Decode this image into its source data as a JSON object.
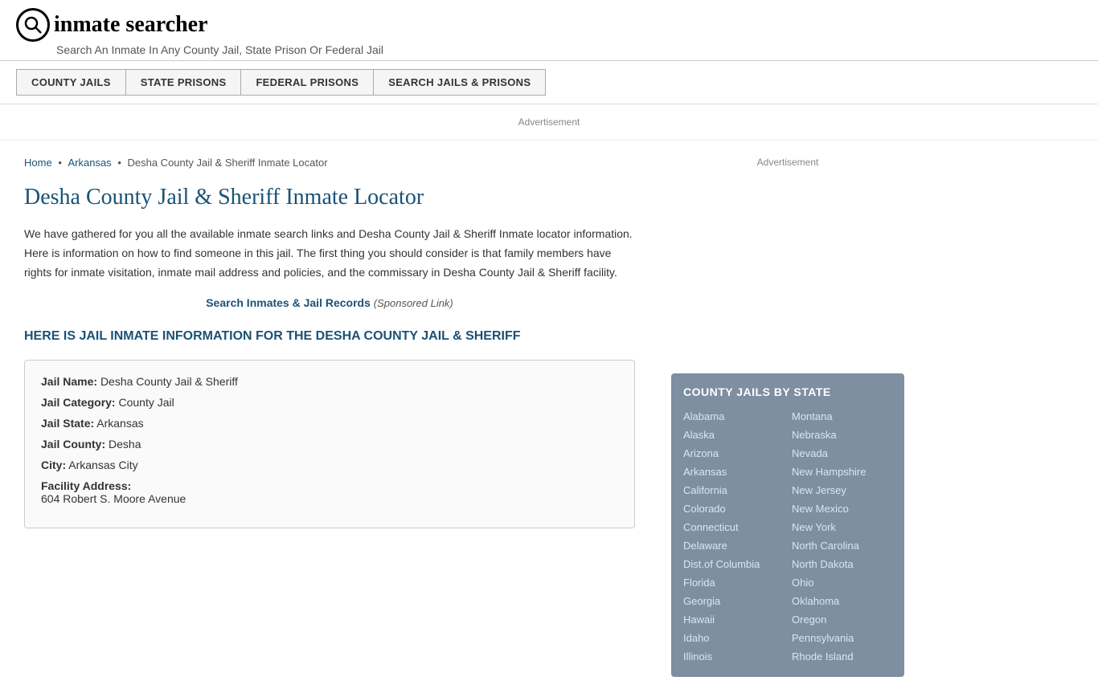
{
  "header": {
    "logo_icon": "🔍",
    "logo_text": "inmate searcher",
    "tagline": "Search An Inmate In Any County Jail, State Prison Or Federal Jail"
  },
  "nav": {
    "items": [
      {
        "label": "COUNTY JAILS",
        "id": "county-jails"
      },
      {
        "label": "STATE PRISONS",
        "id": "state-prisons"
      },
      {
        "label": "FEDERAL PRISONS",
        "id": "federal-prisons"
      },
      {
        "label": "SEARCH JAILS & PRISONS",
        "id": "search-jails-prisons"
      }
    ]
  },
  "ad_label": "Advertisement",
  "breadcrumb": {
    "home": "Home",
    "state": "Arkansas",
    "current": "Desha County Jail & Sheriff Inmate Locator"
  },
  "page_title": "Desha County Jail & Sheriff Inmate Locator",
  "intro_text": "We have gathered for you all the available inmate search links and Desha County Jail & Sheriff Inmate locator information. Here is information on how to find someone in this jail. The first thing you should consider is that family members have rights for inmate visitation, inmate mail address and policies, and the commissary in Desha County Jail & Sheriff facility.",
  "sponsored_link": {
    "text": "Search Inmates & Jail Records",
    "note": "(Sponsored Link)"
  },
  "section_heading": "HERE IS JAIL INMATE INFORMATION FOR THE DESHA COUNTY JAIL & SHERIFF",
  "jail_info": {
    "name_label": "Jail Name:",
    "name_value": "Desha County Jail & Sheriff",
    "category_label": "Jail Category:",
    "category_value": "County Jail",
    "state_label": "Jail State:",
    "state_value": "Arkansas",
    "county_label": "Jail County:",
    "county_value": "Desha",
    "city_label": "City:",
    "city_value": "Arkansas City",
    "address_label": "Facility Address:",
    "address_value": "604 Robert S. Moore Avenue"
  },
  "sidebar": {
    "ad_label": "Advertisement",
    "state_section_title": "COUNTY JAILS BY STATE",
    "states_col1": [
      "Alabama",
      "Alaska",
      "Arizona",
      "Arkansas",
      "California",
      "Colorado",
      "Connecticut",
      "Delaware",
      "Dist.of Columbia",
      "Florida",
      "Georgia",
      "Hawaii",
      "Idaho",
      "Illinois"
    ],
    "states_col2": [
      "Montana",
      "Nebraska",
      "Nevada",
      "New Hampshire",
      "New Jersey",
      "New Mexico",
      "New York",
      "North Carolina",
      "North Dakota",
      "Ohio",
      "Oklahoma",
      "Oregon",
      "Pennsylvania",
      "Rhode Island"
    ]
  }
}
